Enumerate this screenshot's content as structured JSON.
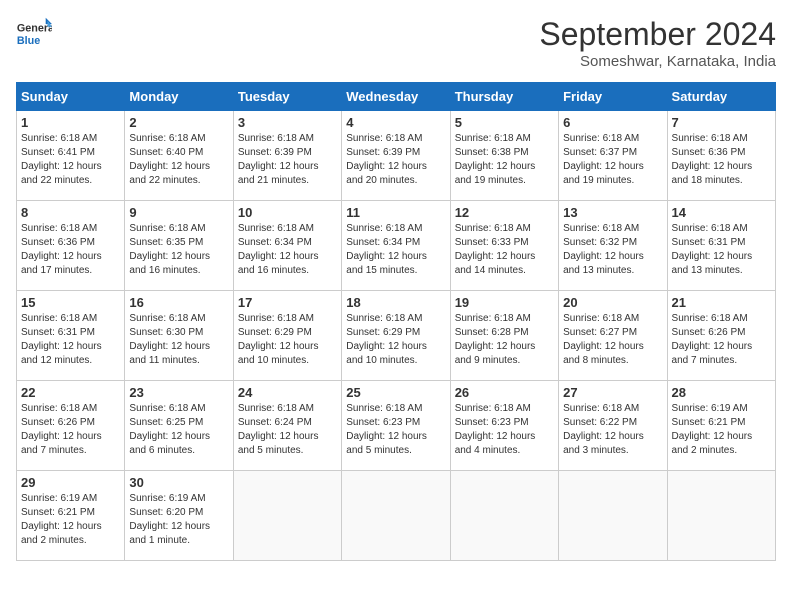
{
  "header": {
    "logo_line1": "General",
    "logo_line2": "Blue",
    "main_title": "September 2024",
    "subtitle": "Someshwar, Karnataka, India"
  },
  "weekdays": [
    "Sunday",
    "Monday",
    "Tuesday",
    "Wednesday",
    "Thursday",
    "Friday",
    "Saturday"
  ],
  "weeks": [
    [
      {
        "day": "1",
        "info": "Sunrise: 6:18 AM\nSunset: 6:41 PM\nDaylight: 12 hours\nand 22 minutes."
      },
      {
        "day": "2",
        "info": "Sunrise: 6:18 AM\nSunset: 6:40 PM\nDaylight: 12 hours\nand 22 minutes."
      },
      {
        "day": "3",
        "info": "Sunrise: 6:18 AM\nSunset: 6:39 PM\nDaylight: 12 hours\nand 21 minutes."
      },
      {
        "day": "4",
        "info": "Sunrise: 6:18 AM\nSunset: 6:39 PM\nDaylight: 12 hours\nand 20 minutes."
      },
      {
        "day": "5",
        "info": "Sunrise: 6:18 AM\nSunset: 6:38 PM\nDaylight: 12 hours\nand 19 minutes."
      },
      {
        "day": "6",
        "info": "Sunrise: 6:18 AM\nSunset: 6:37 PM\nDaylight: 12 hours\nand 19 minutes."
      },
      {
        "day": "7",
        "info": "Sunrise: 6:18 AM\nSunset: 6:36 PM\nDaylight: 12 hours\nand 18 minutes."
      }
    ],
    [
      {
        "day": "8",
        "info": "Sunrise: 6:18 AM\nSunset: 6:36 PM\nDaylight: 12 hours\nand 17 minutes."
      },
      {
        "day": "9",
        "info": "Sunrise: 6:18 AM\nSunset: 6:35 PM\nDaylight: 12 hours\nand 16 minutes."
      },
      {
        "day": "10",
        "info": "Sunrise: 6:18 AM\nSunset: 6:34 PM\nDaylight: 12 hours\nand 16 minutes."
      },
      {
        "day": "11",
        "info": "Sunrise: 6:18 AM\nSunset: 6:34 PM\nDaylight: 12 hours\nand 15 minutes."
      },
      {
        "day": "12",
        "info": "Sunrise: 6:18 AM\nSunset: 6:33 PM\nDaylight: 12 hours\nand 14 minutes."
      },
      {
        "day": "13",
        "info": "Sunrise: 6:18 AM\nSunset: 6:32 PM\nDaylight: 12 hours\nand 13 minutes."
      },
      {
        "day": "14",
        "info": "Sunrise: 6:18 AM\nSunset: 6:31 PM\nDaylight: 12 hours\nand 13 minutes."
      }
    ],
    [
      {
        "day": "15",
        "info": "Sunrise: 6:18 AM\nSunset: 6:31 PM\nDaylight: 12 hours\nand 12 minutes."
      },
      {
        "day": "16",
        "info": "Sunrise: 6:18 AM\nSunset: 6:30 PM\nDaylight: 12 hours\nand 11 minutes."
      },
      {
        "day": "17",
        "info": "Sunrise: 6:18 AM\nSunset: 6:29 PM\nDaylight: 12 hours\nand 10 minutes."
      },
      {
        "day": "18",
        "info": "Sunrise: 6:18 AM\nSunset: 6:29 PM\nDaylight: 12 hours\nand 10 minutes."
      },
      {
        "day": "19",
        "info": "Sunrise: 6:18 AM\nSunset: 6:28 PM\nDaylight: 12 hours\nand 9 minutes."
      },
      {
        "day": "20",
        "info": "Sunrise: 6:18 AM\nSunset: 6:27 PM\nDaylight: 12 hours\nand 8 minutes."
      },
      {
        "day": "21",
        "info": "Sunrise: 6:18 AM\nSunset: 6:26 PM\nDaylight: 12 hours\nand 7 minutes."
      }
    ],
    [
      {
        "day": "22",
        "info": "Sunrise: 6:18 AM\nSunset: 6:26 PM\nDaylight: 12 hours\nand 7 minutes."
      },
      {
        "day": "23",
        "info": "Sunrise: 6:18 AM\nSunset: 6:25 PM\nDaylight: 12 hours\nand 6 minutes."
      },
      {
        "day": "24",
        "info": "Sunrise: 6:18 AM\nSunset: 6:24 PM\nDaylight: 12 hours\nand 5 minutes."
      },
      {
        "day": "25",
        "info": "Sunrise: 6:18 AM\nSunset: 6:23 PM\nDaylight: 12 hours\nand 5 minutes."
      },
      {
        "day": "26",
        "info": "Sunrise: 6:18 AM\nSunset: 6:23 PM\nDaylight: 12 hours\nand 4 minutes."
      },
      {
        "day": "27",
        "info": "Sunrise: 6:18 AM\nSunset: 6:22 PM\nDaylight: 12 hours\nand 3 minutes."
      },
      {
        "day": "28",
        "info": "Sunrise: 6:19 AM\nSunset: 6:21 PM\nDaylight: 12 hours\nand 2 minutes."
      }
    ],
    [
      {
        "day": "29",
        "info": "Sunrise: 6:19 AM\nSunset: 6:21 PM\nDaylight: 12 hours\nand 2 minutes."
      },
      {
        "day": "30",
        "info": "Sunrise: 6:19 AM\nSunset: 6:20 PM\nDaylight: 12 hours\nand 1 minute."
      },
      {
        "day": "",
        "info": ""
      },
      {
        "day": "",
        "info": ""
      },
      {
        "day": "",
        "info": ""
      },
      {
        "day": "",
        "info": ""
      },
      {
        "day": "",
        "info": ""
      }
    ]
  ]
}
